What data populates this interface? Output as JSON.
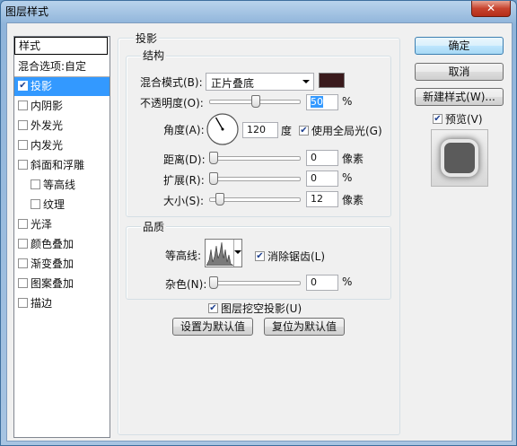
{
  "window": {
    "title": "图层样式",
    "close_label": "✕"
  },
  "list": {
    "header": "样式",
    "items": [
      {
        "label": "混合选项:自定",
        "checkbox": false,
        "checked": false
      },
      {
        "label": "投影",
        "checkbox": true,
        "checked": true,
        "selected": true
      },
      {
        "label": "内阴影",
        "checkbox": true,
        "checked": false
      },
      {
        "label": "外发光",
        "checkbox": true,
        "checked": false
      },
      {
        "label": "内发光",
        "checkbox": true,
        "checked": false
      },
      {
        "label": "斜面和浮雕",
        "checkbox": true,
        "checked": false
      },
      {
        "label": "等高线",
        "checkbox": true,
        "checked": false,
        "indent": true
      },
      {
        "label": "纹理",
        "checkbox": true,
        "checked": false,
        "indent": true
      },
      {
        "label": "光泽",
        "checkbox": true,
        "checked": false
      },
      {
        "label": "颜色叠加",
        "checkbox": true,
        "checked": false
      },
      {
        "label": "渐变叠加",
        "checkbox": true,
        "checked": false
      },
      {
        "label": "图案叠加",
        "checkbox": true,
        "checked": false
      },
      {
        "label": "描边",
        "checkbox": true,
        "checked": false
      }
    ]
  },
  "drop_shadow": {
    "title": "投影",
    "structure": {
      "title": "结构",
      "blend_mode_label": "混合模式(B):",
      "blend_mode_value": "正片叠底",
      "shadow_color": "#3a1a1c",
      "opacity_label": "不透明度(O):",
      "opacity_value": "50",
      "opacity_unit": "%",
      "opacity_fraction": 0.5,
      "angle_label": "角度(A):",
      "angle_value": "120",
      "angle_unit": "度",
      "global_light_label": "使用全局光(G)",
      "global_light_checked": true,
      "distance_label": "距离(D):",
      "distance_value": "0",
      "distance_unit": "像素",
      "spread_label": "扩展(R):",
      "spread_value": "0",
      "spread_unit": "%",
      "size_label": "大小(S):",
      "size_value": "12",
      "size_unit": "像素"
    },
    "quality": {
      "title": "品质",
      "contour_label": "等高线:",
      "anti_alias_label": "消除锯齿(L)",
      "anti_alias_checked": true,
      "noise_label": "杂色(N):",
      "noise_value": "0",
      "noise_unit": "%"
    },
    "knockout_label": "图层挖空投影(U)",
    "knockout_checked": true,
    "make_default_label": "设置为默认值",
    "reset_default_label": "复位为默认值"
  },
  "buttons": {
    "ok": "确定",
    "cancel": "取消",
    "new_style": "新建样式(W)...",
    "preview_label": "预览(V)",
    "preview_checked": true
  }
}
